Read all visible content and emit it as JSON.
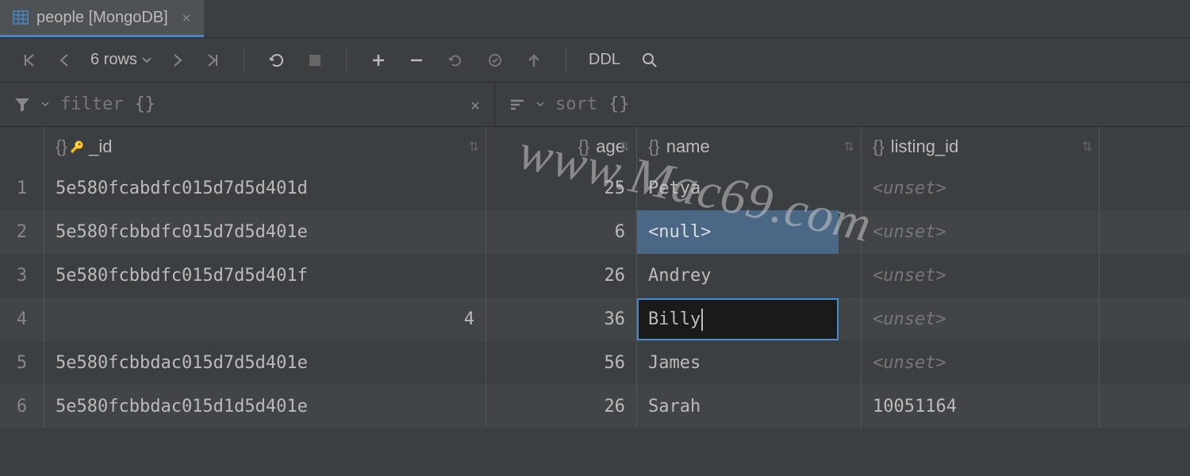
{
  "tab": {
    "title": "people [MongoDB]"
  },
  "toolbar": {
    "row_count": "6 rows",
    "ddl": "DDL"
  },
  "filter": {
    "label": "filter",
    "braces": "{}"
  },
  "sort": {
    "label": "sort",
    "braces": "{}"
  },
  "columns": {
    "id": "_id",
    "age": "age",
    "name": "name",
    "listing": "listing_id"
  },
  "rows": [
    {
      "num": "1",
      "id": "5e580fcabdfc015d7d5d401d",
      "id_right": false,
      "age": "25",
      "name": "Petya",
      "name_state": "normal",
      "listing": "<unset>",
      "listing_state": "unset"
    },
    {
      "num": "2",
      "id": "5e580fcbbdfc015d7d5d401e",
      "id_right": false,
      "age": "6",
      "name": "<null>",
      "name_state": "selected",
      "listing": "<unset>",
      "listing_state": "unset"
    },
    {
      "num": "3",
      "id": "5e580fcbbdfc015d7d5d401f",
      "id_right": false,
      "age": "26",
      "name": "Andrey",
      "name_state": "normal",
      "listing": "<unset>",
      "listing_state": "unset"
    },
    {
      "num": "4",
      "id": "4",
      "id_right": true,
      "age": "36",
      "name": "Billy",
      "name_state": "editing",
      "listing": "<unset>",
      "listing_state": "unset"
    },
    {
      "num": "5",
      "id": "5e580fcbbdac015d7d5d401e",
      "id_right": false,
      "age": "56",
      "name": "James",
      "name_state": "normal",
      "listing": "<unset>",
      "listing_state": "unset"
    },
    {
      "num": "6",
      "id": "5e580fcbbdac015d1d5d401e",
      "id_right": false,
      "age": "26",
      "name": "Sarah",
      "name_state": "normal",
      "listing": "10051164",
      "listing_state": "normal"
    }
  ],
  "watermark": "www.Mac69.com"
}
